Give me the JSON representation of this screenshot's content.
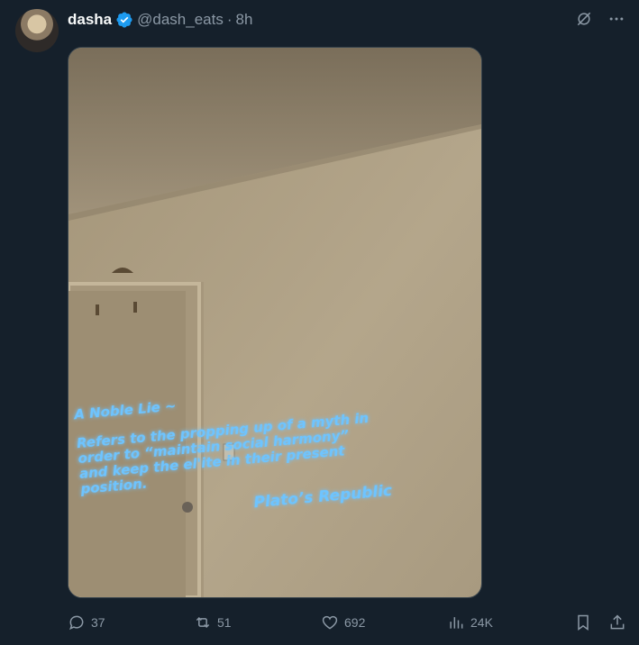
{
  "post": {
    "display_name": "dasha",
    "handle": "@dash_eats",
    "separator": "·",
    "time": "8h",
    "verified_icon": "verified-badge-icon",
    "accent": "#1d9bf0"
  },
  "top_icons": [
    "grok-icon",
    "more-icon"
  ],
  "image_text": {
    "line1": "A Noble Lie ~",
    "line2": "Refers to the propping up of a myth in",
    "line3": "order to “maintain social harmony”",
    "line4": "and keep the el'ite in their present",
    "line5": "position.",
    "line6": "Plato’s Republic"
  },
  "actions": {
    "replies": "37",
    "reposts": "51",
    "likes": "692",
    "views": "24K"
  },
  "colors": {
    "background": "#15202b",
    "text_primary": "#f7f9f9",
    "text_secondary": "#8b98a5",
    "projection_text": "#6ec4ff"
  }
}
